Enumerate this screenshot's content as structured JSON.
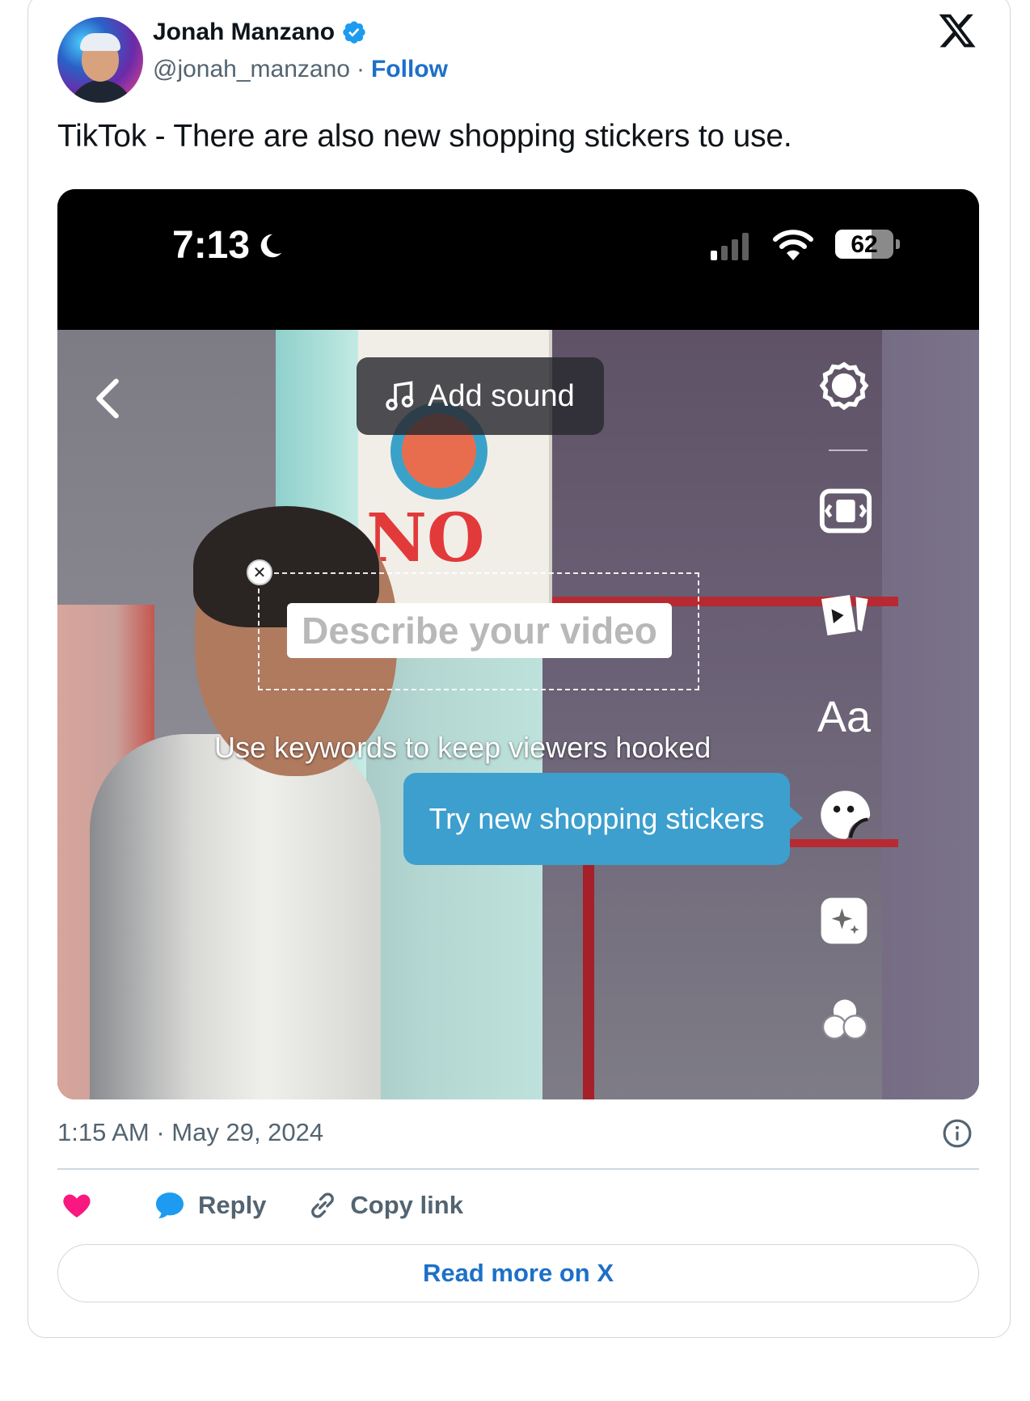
{
  "author": {
    "name": "Jonah Manzano",
    "handle": "@jonah_manzano",
    "separator": "·",
    "follow_label": "Follow",
    "verified": true
  },
  "tweet": {
    "text": "TikTok - There are also new shopping stickers to use."
  },
  "media": {
    "status_bar": {
      "time": "7:13",
      "battery": "62",
      "battery_level": 0.62,
      "signal_bars_lit": 1
    },
    "add_sound_label": "Add sound",
    "describe_placeholder": "Describe your video",
    "keywords_hint": "Use keywords to keep viewers hooked",
    "tooltip_label": "Try new shopping stickers",
    "text_tool_label": "Aa"
  },
  "footer": {
    "timestamp": "1:15 AM · May 29, 2024",
    "reply_label": "Reply",
    "copy_link_label": "Copy link",
    "read_more_label": "Read more on X"
  },
  "colors": {
    "accent": "#1d70c8",
    "like": "#f91880",
    "tooltip": "#3c9fce",
    "verified": "#1d9bf0"
  },
  "icons": [
    "x-logo-icon",
    "verified-badge-icon",
    "back-chevron-icon",
    "music-note-icon",
    "settings-icon",
    "flip-icon",
    "sticker-icon",
    "text-icon",
    "emoji-sticker-icon",
    "effects-icon",
    "filters-icon",
    "info-icon",
    "heart-icon",
    "reply-icon",
    "link-icon"
  ]
}
